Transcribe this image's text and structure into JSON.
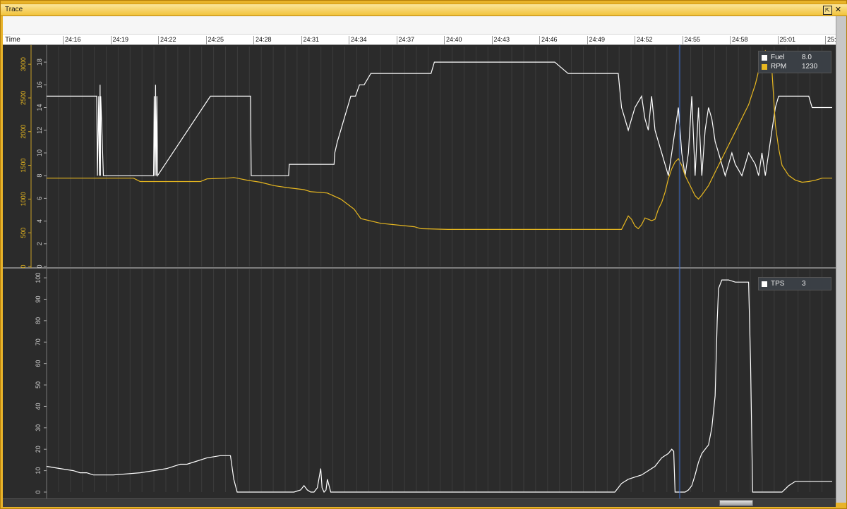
{
  "window": {
    "title": "Trace"
  },
  "time_axis": {
    "label": "Time",
    "ticks": [
      "24:16",
      "24:19",
      "24:22",
      "24:25",
      "24:28",
      "24:31",
      "24:34",
      "24:37",
      "24:40",
      "24:43",
      "24:46",
      "24:49",
      "24:52",
      "24:55",
      "24:58",
      "25:01",
      "25:"
    ]
  },
  "colors": {
    "fuel": "#ffffff",
    "rpm": "#e8b820",
    "tps": "#ffffff",
    "cursor": "#3b6fd4",
    "grid": "#3c3c3c"
  },
  "legend_top": {
    "items": [
      {
        "name": "Fuel",
        "value": "8.0",
        "color": "#ffffff"
      },
      {
        "name": "RPM",
        "value": "1230",
        "color": "#e8b820"
      }
    ]
  },
  "legend_bottom": {
    "items": [
      {
        "name": "TPS",
        "value": "3",
        "color": "#ffffff"
      }
    ]
  },
  "chart_data": [
    {
      "type": "line",
      "title": "",
      "xlabel": "Time",
      "x_ticks": [
        "24:16",
        "24:19",
        "24:22",
        "24:25",
        "24:28",
        "24:31",
        "24:34",
        "24:37",
        "24:40",
        "24:43",
        "24:46",
        "24:49",
        "24:52",
        "24:55",
        "24:58",
        "25:01",
        "25:"
      ],
      "left_axis": {
        "ticks": [
          0,
          2,
          4,
          6,
          8,
          10,
          12,
          14,
          16,
          18
        ],
        "ylim": [
          0,
          19
        ]
      },
      "right_axis": {
        "ticks": [
          0,
          500,
          1000,
          1500,
          2000,
          2500,
          3000
        ],
        "ylim": [
          0,
          3200
        ]
      },
      "series": [
        {
          "name": "Fuel",
          "axis": "left",
          "x": [
            0,
            75,
            76,
            78,
            79,
            80,
            80.5,
            81,
            85,
            160,
            161,
            162,
            163,
            164,
            165,
            166,
            245,
            305,
            306,
            362,
            363,
            430,
            431,
            435,
            440,
            445,
            450,
            455,
            462,
            468,
            475,
            485,
            490,
            495,
            510,
            570,
            575,
            580,
            640,
            700,
            760,
            780,
            790,
            855,
            860,
            865,
            870,
            875,
            880,
            890,
            895,
            900,
            905,
            910,
            915,
            920,
            925,
            930,
            935,
            940,
            945,
            950,
            955,
            960,
            965,
            970,
            975,
            980,
            985,
            990,
            995,
            1000,
            1005,
            1010,
            1015,
            1020,
            1025,
            1030,
            1040,
            1050,
            1060,
            1065,
            1070,
            1075,
            1080,
            1085,
            1090,
            1095,
            1100,
            1120,
            1140,
            1145,
            1150,
            1175
          ],
          "y": [
            15,
            15,
            8,
            15,
            8,
            16,
            8,
            15,
            8,
            8,
            15,
            8,
            16,
            8,
            15,
            8,
            15,
            15,
            8,
            8,
            9,
            9,
            10,
            11,
            12,
            13,
            14,
            15,
            15,
            16,
            16,
            17,
            17,
            17,
            17,
            17,
            17,
            18,
            18,
            18,
            18,
            17,
            17,
            17,
            14,
            13,
            12,
            13,
            14,
            15,
            13,
            12,
            15,
            12,
            11,
            10,
            9,
            8,
            10,
            12,
            14,
            10,
            8,
            10,
            15,
            8,
            14,
            8,
            12,
            14,
            13,
            11,
            10,
            9,
            8,
            9,
            10,
            9,
            8,
            10,
            9,
            8,
            10,
            8,
            10,
            12,
            14,
            15,
            15,
            15,
            15,
            14,
            14,
            14
          ]
        },
        {
          "name": "RPM",
          "axis": "right",
          "x": [
            0,
            130,
            140,
            230,
            240,
            270,
            280,
            290,
            300,
            320,
            340,
            360,
            385,
            395,
            420,
            440,
            460,
            470,
            500,
            540,
            550,
            560,
            600,
            700,
            800,
            860,
            865,
            870,
            875,
            880,
            885,
            890,
            895,
            900,
            905,
            910,
            915,
            920,
            925,
            930,
            935,
            940,
            945,
            950,
            955,
            960,
            965,
            970,
            975,
            980,
            990,
            1000,
            1010,
            1020,
            1030,
            1040,
            1050,
            1055,
            1060,
            1065,
            1070,
            1075,
            1080,
            1085,
            1090,
            1095,
            1100,
            1110,
            1120,
            1130,
            1140,
            1150,
            1160,
            1175
          ],
          "y": [
            1310,
            1310,
            1260,
            1260,
            1300,
            1310,
            1320,
            1300,
            1280,
            1250,
            1200,
            1170,
            1140,
            1110,
            1090,
            1000,
            850,
            710,
            640,
            600,
            590,
            560,
            550,
            550,
            550,
            550,
            650,
            750,
            700,
            600,
            560,
            620,
            720,
            700,
            680,
            700,
            850,
            950,
            1100,
            1300,
            1450,
            1550,
            1600,
            1500,
            1350,
            1250,
            1150,
            1050,
            1000,
            1060,
            1200,
            1400,
            1600,
            1800,
            2000,
            2200,
            2400,
            2550,
            2700,
            2900,
            3100,
            3200,
            3100,
            2900,
            2100,
            1750,
            1500,
            1350,
            1280,
            1250,
            1260,
            1280,
            1310,
            1310
          ]
        }
      ]
    },
    {
      "type": "line",
      "title": "",
      "xlabel": "Time",
      "left_axis": {
        "ticks": [
          0,
          10,
          20,
          30,
          40,
          50,
          60,
          70,
          80,
          90,
          100
        ],
        "ylim": [
          0,
          102
        ]
      },
      "series": [
        {
          "name": "TPS",
          "axis": "left",
          "x": [
            0,
            20,
            40,
            50,
            60,
            70,
            80,
            100,
            140,
            160,
            180,
            200,
            210,
            220,
            240,
            260,
            270,
            275,
            280,
            285,
            290,
            300,
            330,
            350,
            370,
            380,
            385,
            390,
            395,
            400,
            405,
            410,
            412,
            415,
            418,
            420,
            425,
            440,
            600,
            800,
            850,
            855,
            860,
            865,
            870,
            880,
            890,
            900,
            910,
            915,
            920,
            925,
            930,
            935,
            938,
            940,
            945,
            950,
            955,
            960,
            965,
            970,
            975,
            980,
            985,
            990,
            995,
            1000,
            1003,
            1005,
            1010,
            1020,
            1030,
            1040,
            1045,
            1050,
            1053,
            1056,
            1060,
            1080,
            1100,
            1110,
            1120,
            1140,
            1160,
            1175
          ],
          "y": [
            12,
            11,
            10,
            9,
            9,
            8,
            8,
            8,
            9,
            10,
            11,
            13,
            13,
            14,
            16,
            17,
            17,
            17,
            6,
            0,
            0,
            0,
            0,
            0,
            0,
            1,
            3,
            1,
            0,
            0,
            2,
            11,
            2,
            0,
            1,
            6,
            0,
            0,
            0,
            0,
            0,
            2,
            4,
            5,
            6,
            7,
            8,
            10,
            12,
            14,
            16,
            17,
            18,
            20,
            19,
            0,
            0,
            0,
            0,
            1,
            3,
            8,
            14,
            18,
            20,
            22,
            30,
            45,
            80,
            95,
            99,
            99,
            98,
            98,
            98,
            98,
            60,
            0,
            0,
            0,
            0,
            3,
            5,
            5,
            5,
            5
          ]
        }
      ]
    }
  ]
}
